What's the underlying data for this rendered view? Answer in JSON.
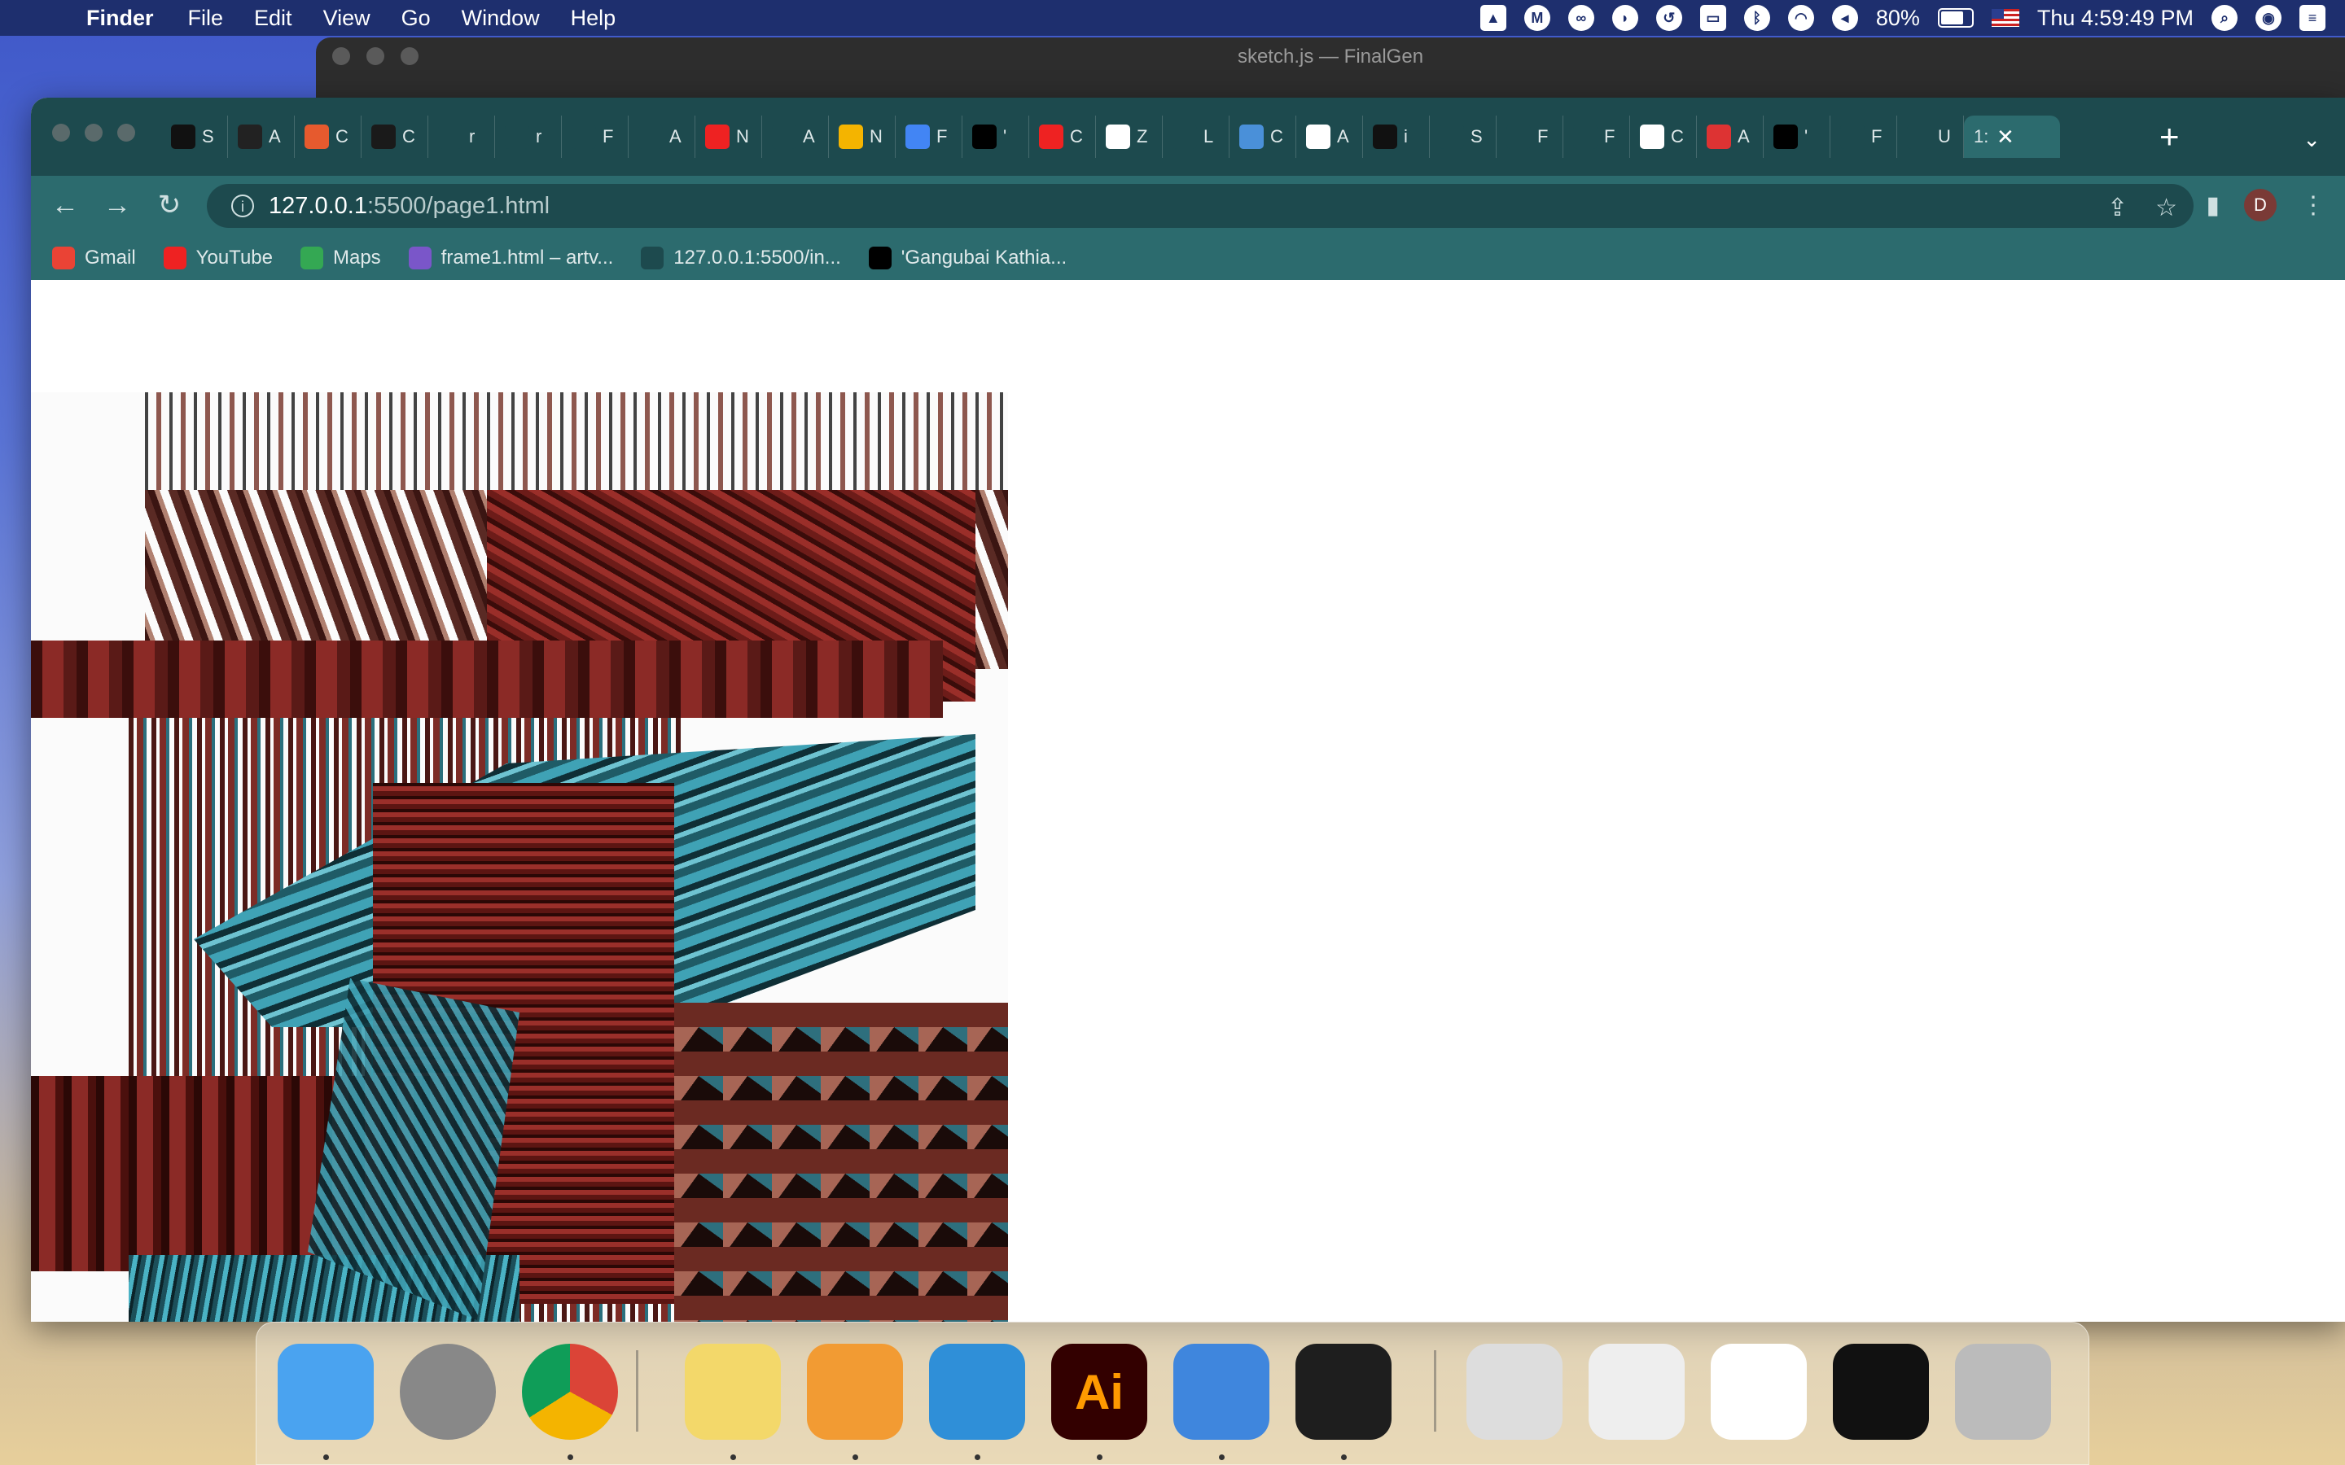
{
  "menubar": {
    "apple": "",
    "app_name": "Finder",
    "menus": [
      "File",
      "Edit",
      "View",
      "Go",
      "Window",
      "Help"
    ],
    "battery": "80%",
    "clock": "Thu 4:59:49 PM"
  },
  "back_window": {
    "title": "sketch.js — FinalGen"
  },
  "browser": {
    "tabs": [
      {
        "label": "S",
        "icon": "grid-icon",
        "color": "#111"
      },
      {
        "label": "A",
        "icon": "m-icon",
        "color": "#222"
      },
      {
        "label": "C",
        "icon": "codepen-icon",
        "color": "#e65a2e"
      },
      {
        "label": "C",
        "icon": "google-icon",
        "color": "#1a1a1a"
      },
      {
        "label": "r",
        "icon": "star-icon",
        "color": "#1d4a4e"
      },
      {
        "label": "r",
        "icon": "star-icon",
        "color": "#1d4a4e"
      },
      {
        "label": "F",
        "icon": "globe-icon",
        "color": "#1d4a4e"
      },
      {
        "label": "A",
        "icon": "nyt-icon",
        "color": "#1d4a4e"
      },
      {
        "label": "N",
        "icon": "youtube-icon",
        "color": "#e22"
      },
      {
        "label": "A",
        "icon": "nyt-icon",
        "color": "#1d4a4e"
      },
      {
        "label": "N",
        "icon": "drive-icon",
        "color": "#f4b400"
      },
      {
        "label": "F",
        "icon": "docs-icon",
        "color": "#4285f4"
      },
      {
        "label": "'",
        "icon": "dmt-icon",
        "color": "#000"
      },
      {
        "label": "C",
        "icon": "youtube-icon",
        "color": "#e22"
      },
      {
        "label": "Z",
        "icon": "gmail-icon",
        "color": "#fff"
      },
      {
        "label": "L",
        "icon": "globe-icon",
        "color": "#1d4a4e"
      },
      {
        "label": "C",
        "icon": "puzzle-icon",
        "color": "#4a90d9"
      },
      {
        "label": "A",
        "icon": "ring-icon",
        "color": "#fff"
      },
      {
        "label": "i",
        "icon": "spiral-icon",
        "color": "#111"
      },
      {
        "label": "S",
        "icon": "nyt-icon",
        "color": "#1d4a4e"
      },
      {
        "label": "F",
        "icon": "globe-icon",
        "color": "#1d4a4e"
      },
      {
        "label": "F",
        "icon": "globe-icon",
        "color": "#1d4a4e"
      },
      {
        "label": "C",
        "icon": "colab-icon",
        "color": "#fff"
      },
      {
        "label": "A",
        "icon": "n-icon",
        "color": "#d33"
      },
      {
        "label": "'",
        "icon": "dmt-icon",
        "color": "#000"
      },
      {
        "label": "F",
        "icon": "figma-icon",
        "color": "#1d4a4e"
      },
      {
        "label": "U",
        "icon": "figma-icon",
        "color": "#1d4a4e"
      }
    ],
    "active_tab": {
      "label": "1:",
      "icon": "file-icon"
    },
    "url_host": "127.0.0.1",
    "url_rest": ":5500/page1.html",
    "profile_initial": "D",
    "bookmarks": [
      {
        "label": "Gmail",
        "icon": "gmail-icon",
        "color": "#ea4335"
      },
      {
        "label": "YouTube",
        "icon": "youtube-icon",
        "color": "#e22"
      },
      {
        "label": "Maps",
        "icon": "maps-icon",
        "color": "#34a853"
      },
      {
        "label": "frame1.html – artv...",
        "icon": "artv-icon",
        "color": "#7a56c9"
      },
      {
        "label": "127.0.0.1:5500/in...",
        "icon": "globe-icon",
        "color": "#1d4a4e"
      },
      {
        "label": "'Gangubai Kathia...",
        "icon": "dmt-icon",
        "color": "#000"
      }
    ]
  },
  "page": {
    "line1": "undefined",
    "line2": "undefined"
  },
  "dock": {
    "items": [
      {
        "name": "finder",
        "color": "#4aa3f0",
        "running": true
      },
      {
        "name": "launchpad",
        "color": "#888",
        "running": false
      },
      {
        "name": "chrome",
        "color": "#fff",
        "running": true
      },
      {
        "name": "stickies",
        "color": "#f3d86a",
        "running": true
      },
      {
        "name": "pages",
        "color": "#f29b33",
        "running": true
      },
      {
        "name": "vscode",
        "color": "#2f8fd8",
        "running": true
      },
      {
        "name": "illustrator",
        "color": "#330000",
        "running": true
      },
      {
        "name": "keynote",
        "color": "#3f86dd",
        "running": true
      },
      {
        "name": "figma",
        "color": "#1e1e1e",
        "running": true
      },
      {
        "name": "recent-document",
        "color": "#ddd",
        "running": false
      },
      {
        "name": "chrome-window-1",
        "color": "#eee",
        "running": false
      },
      {
        "name": "document-window",
        "color": "#fff",
        "running": false
      },
      {
        "name": "chrome-window-2",
        "color": "#111",
        "running": false
      },
      {
        "name": "trash",
        "color": "#bbb",
        "running": false
      }
    ],
    "illustrator_label": "Ai"
  },
  "colors": {
    "menubar": "#1e2f6e",
    "chrome_frame": "#1d4a4e",
    "chrome_toolbar": "#2c6b6e",
    "art_red": "#8b2a26",
    "art_teal": "#3fa2b5"
  }
}
